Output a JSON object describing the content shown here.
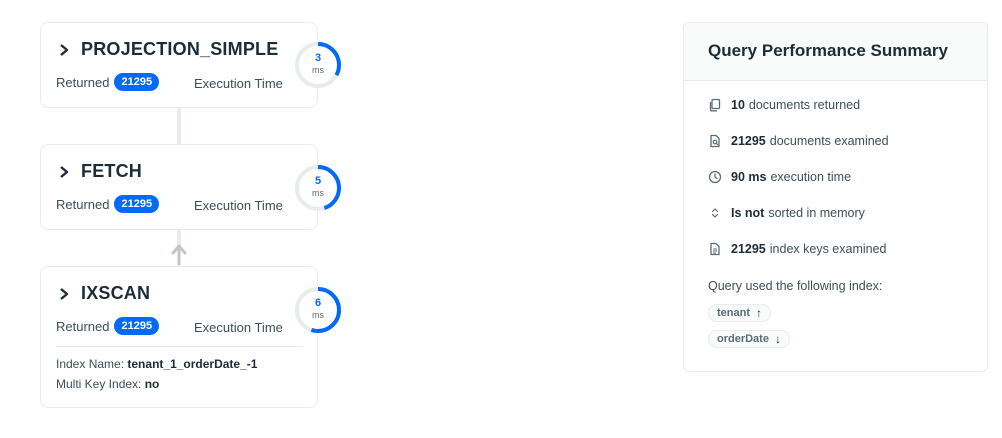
{
  "stages": [
    {
      "name": "PROJECTION_SIMPLE",
      "returned_label": "Returned",
      "returned": "21295",
      "exec_label": "Execution Time",
      "ms": "3",
      "unit": "ms",
      "progress": 0.33
    },
    {
      "name": "FETCH",
      "returned_label": "Returned",
      "returned": "21295",
      "exec_label": "Execution Time",
      "ms": "5",
      "unit": "ms",
      "progress": 0.45
    },
    {
      "name": "IXSCAN",
      "returned_label": "Returned",
      "returned": "21295",
      "exec_label": "Execution Time",
      "ms": "6",
      "unit": "ms",
      "progress": 0.55,
      "index_name_label": "Index Name:",
      "index_name": "tenant_1_orderDate_-1",
      "multikey_label": "Multi Key Index:",
      "multikey": "no"
    }
  ],
  "summary": {
    "title": "Query Performance Summary",
    "metrics": [
      {
        "icon": "documents-icon",
        "value": "10",
        "text": "documents returned"
      },
      {
        "icon": "document-search-icon",
        "value": "21295",
        "text": "documents examined"
      },
      {
        "icon": "clock-icon",
        "value": "90 ms",
        "text": "execution time"
      },
      {
        "icon": "sort-icon",
        "value": "Is not",
        "text": "sorted in memory"
      },
      {
        "icon": "index-file-icon",
        "value": "21295",
        "text": "index keys examined"
      }
    ],
    "index_caption": "Query used the following index:",
    "index_keys": [
      {
        "name": "tenant",
        "direction": "↑"
      },
      {
        "name": "orderDate",
        "direction": "↓"
      }
    ]
  },
  "colors": {
    "accent": "#016bf8",
    "gauge_track": "#e8edeb",
    "text": "#1c2d38"
  }
}
